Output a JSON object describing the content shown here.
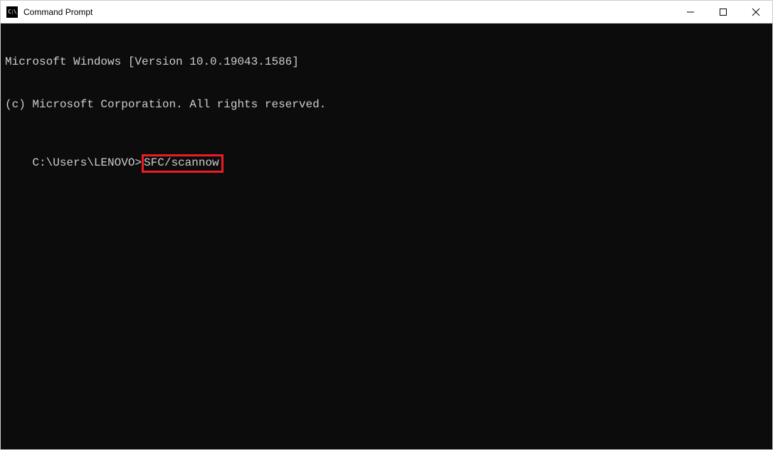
{
  "window": {
    "title": "Command Prompt"
  },
  "terminal": {
    "line1": "Microsoft Windows [Version 10.0.19043.1586]",
    "line2": "(c) Microsoft Corporation. All rights reserved.",
    "blank": "",
    "prompt": "C:\\Users\\LENOVO>",
    "command": "SFC/scannow"
  }
}
